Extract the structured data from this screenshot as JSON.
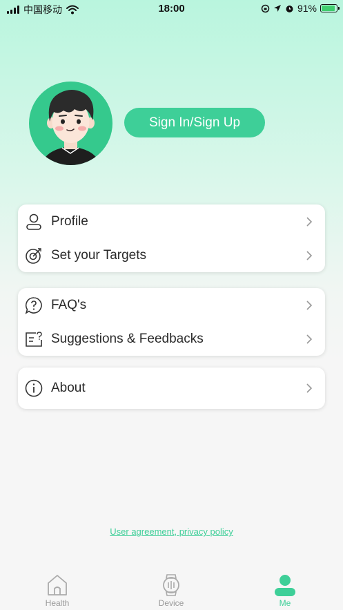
{
  "status_bar": {
    "carrier": "中国移动",
    "time": "18:00",
    "battery": "91%",
    "battery_level": 0.91
  },
  "header": {
    "signin_label": "Sign In/Sign Up"
  },
  "menu": {
    "group1": [
      {
        "label": "Profile",
        "icon": "person-icon"
      },
      {
        "label": "Set your Targets",
        "icon": "target-icon"
      }
    ],
    "group2": [
      {
        "label": "FAQ's",
        "icon": "question-bubble-icon"
      },
      {
        "label": "Suggestions & Feedbacks",
        "icon": "feedback-icon"
      }
    ],
    "group3": [
      {
        "label": "About",
        "icon": "info-icon"
      }
    ]
  },
  "footer": {
    "agreement_link": "User agreement, privacy policy"
  },
  "tabbar": {
    "tabs": [
      {
        "label": "Health",
        "icon": "home-icon"
      },
      {
        "label": "Device",
        "icon": "watch-icon"
      },
      {
        "label": "Me",
        "icon": "person-filled-icon",
        "active": true
      }
    ],
    "accent": "#3ecf98",
    "inactive": "#999999"
  },
  "colors": {
    "accent": "#3ecf98",
    "avatar_bg": "#35c98d"
  }
}
